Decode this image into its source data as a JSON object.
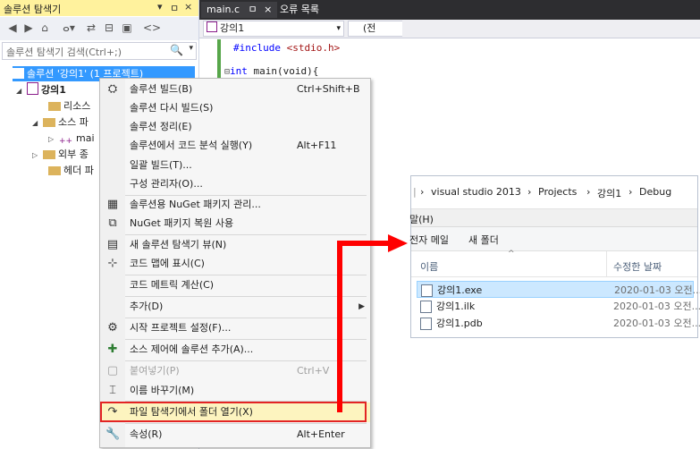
{
  "solution_explorer": {
    "title": "솔루션 탐색기",
    "title_arrow": "▾",
    "title_pin": "ㅁ",
    "title_close": "×",
    "toolbar_icons": [
      "back-icon",
      "forward-icon",
      "home-icon",
      "sync-icon",
      "refresh-icon",
      "collapse-icon",
      "properties-icon",
      "code-icon"
    ],
    "toolbar_glyphs": [
      "◀",
      "▶",
      "⌂",
      "ⴰ▾",
      "⇄",
      "⊟",
      "▣",
      "<>"
    ],
    "search_placeholder": "솔루션 탐색기 검색(Ctrl+;)",
    "search_icon": "🔍",
    "tree": {
      "solution_label": "솔루션 '강의1' (1 프로젝트)",
      "project_label": "강의1",
      "resources_label": "리소스",
      "source_label": "소스 파",
      "main_label": "mai",
      "external_label": "외부 종",
      "header_label": "헤더 파"
    }
  },
  "editor": {
    "tab_main": "main.c",
    "tab_pin": "ㅁ",
    "tab_close": "×",
    "tab_errors": "오류 목록",
    "nav_project": "강의1",
    "nav_scope": "(전",
    "code_include_kw": "#include",
    "code_include_file": " <stdio.h>",
    "code_main_kw": "int",
    "code_main_rest": " main(void){",
    "collapse_glyph": "⊟"
  },
  "context_menu": {
    "items": [
      {
        "label": "솔루션 빌드(B)",
        "shortcut": "Ctrl+Shift+B",
        "icon": "build-icon"
      },
      {
        "label": "솔루션 다시 빌드(S)",
        "shortcut": "",
        "icon": ""
      },
      {
        "label": "솔루션 정리(E)",
        "shortcut": "",
        "icon": ""
      },
      {
        "label": "솔루션에서 코드 분석 실행(Y)",
        "shortcut": "Alt+F11",
        "icon": ""
      },
      {
        "label": "일괄 빌드(T)...",
        "shortcut": "",
        "icon": ""
      },
      {
        "label": "구성 관리자(O)...",
        "shortcut": "",
        "icon": ""
      },
      {
        "label": "솔루션용 NuGet 패키지 관리...",
        "shortcut": "",
        "icon": "nuget-icon"
      },
      {
        "label": "NuGet 패키지 복원 사용",
        "shortcut": "",
        "icon": "nuget-restore-icon"
      },
      {
        "label": "새 솔루션 탐색기 뷰(N)",
        "shortcut": "",
        "icon": "new-view-icon"
      },
      {
        "label": "코드 맵에 표시(C)",
        "shortcut": "",
        "icon": "code-map-icon"
      },
      {
        "label": "코드 메트릭 계산(C)",
        "shortcut": "",
        "icon": ""
      },
      {
        "label": "추가(D)",
        "shortcut": "",
        "icon": "",
        "submenu": "▶"
      },
      {
        "label": "시작 프로젝트 설정(F)...",
        "shortcut": "",
        "icon": "gear-icon"
      },
      {
        "label": "소스 제어에 솔루션 추가(A)...",
        "shortcut": "",
        "icon": "source-control-icon"
      },
      {
        "label": "붙여넣기(P)",
        "shortcut": "Ctrl+V",
        "icon": "paste-icon",
        "disabled": true
      },
      {
        "label": "이름 바꾸기(M)",
        "shortcut": "",
        "icon": "rename-icon"
      },
      {
        "label": "파일 탐색기에서 폴더 열기(X)",
        "shortcut": "",
        "icon": "open-folder-icon",
        "highlighted": true
      },
      {
        "label": "속성(R)",
        "shortcut": "Alt+Enter",
        "icon": "wrench-icon"
      }
    ]
  },
  "file_explorer": {
    "breadcrumb": [
      "visual studio 2013",
      "Projects",
      "강의1",
      "Debug"
    ],
    "breadcrumb_sep": "›",
    "menu_fragment": "말(H)",
    "cmd_email": "전자 메일",
    "cmd_new_folder": "새 폴더",
    "col_name": "이름",
    "col_modified": "수정한 날짜",
    "sort_glyph": "^",
    "files": [
      {
        "name": "강의1.exe",
        "date": "2020-01-03 오전...",
        "selected": true
      },
      {
        "name": "강의1.ilk",
        "date": "2020-01-03 오전..."
      },
      {
        "name": "강의1.pdb",
        "date": "2020-01-03 오전..."
      }
    ]
  },
  "colors": {
    "accent_selection": "#3399ff",
    "highlight_border": "#e32424",
    "arrow": "#ff0000"
  }
}
